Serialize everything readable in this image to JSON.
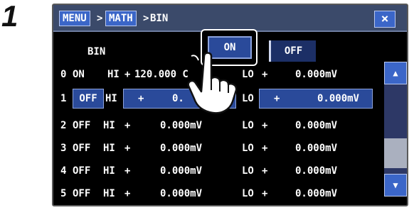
{
  "step_number": "1",
  "header": {
    "crumbs": [
      "MENU",
      "MATH"
    ],
    "separator": ">",
    "current": "BIN",
    "close_symbol": "×"
  },
  "bin": {
    "label": "BIN",
    "on_label": "ON",
    "off_label": "OFF"
  },
  "rows": [
    {
      "index": "0",
      "state": "ON",
      "hi_label": "HI",
      "hi_sign": "+",
      "hi_value": "120.000 C",
      "lo_label": "LO",
      "lo_sign": "+",
      "lo_value": "0.000mV"
    },
    {
      "index": "1",
      "state": "OFF",
      "hi_label": "HI",
      "hi_sign": "+",
      "hi_value": "0.",
      "hi_value_tail": "mV",
      "lo_label": "LO",
      "lo_sign": "+",
      "lo_value": "0.000mV"
    },
    {
      "index": "2",
      "state": "OFF",
      "hi_label": "HI",
      "hi_sign": "+",
      "hi_value": "0.000mV",
      "lo_label": "LO",
      "lo_sign": "+",
      "lo_value": "0.000mV"
    },
    {
      "index": "3",
      "state": "OFF",
      "hi_label": "HI",
      "hi_sign": "+",
      "hi_value": "0.000mV",
      "lo_label": "LO",
      "lo_sign": "+",
      "lo_value": "0.000mV"
    },
    {
      "index": "4",
      "state": "OFF",
      "hi_label": "HI",
      "hi_sign": "+",
      "hi_value": "0.000mV",
      "lo_label": "LO",
      "lo_sign": "+",
      "lo_value": "0.000mV"
    },
    {
      "index": "5",
      "state": "OFF",
      "hi_label": "HI",
      "hi_sign": "+",
      "hi_value": "0.000mV",
      "lo_label": "LO",
      "lo_sign": "+",
      "lo_value": "0.000mV"
    }
  ],
  "scrollbar": {
    "up_icon": "▲",
    "down_icon": "▼"
  },
  "colors": {
    "accent": "#3b66c8",
    "field": "#2a4a9a",
    "background": "#000000",
    "titlebar": "#3b4a6a"
  }
}
